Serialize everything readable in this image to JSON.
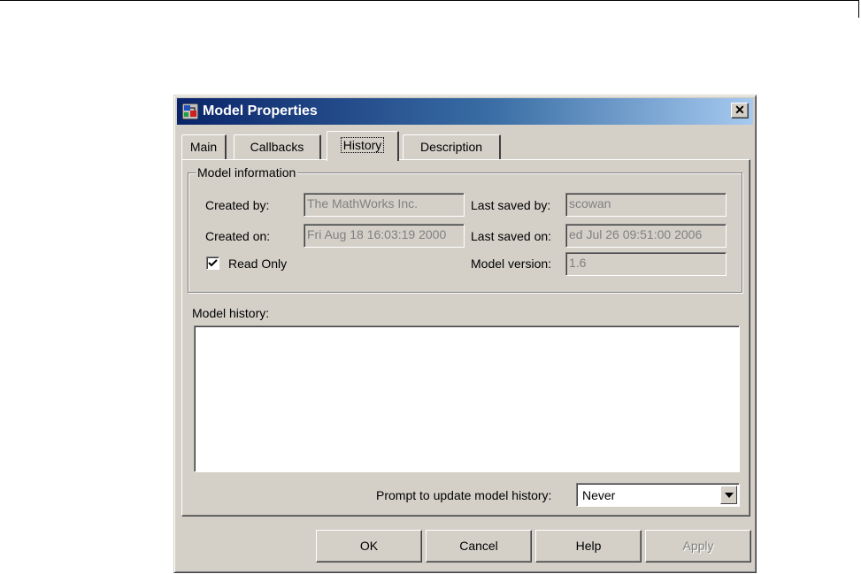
{
  "window": {
    "title": "Model Properties",
    "close_glyph": "✕"
  },
  "tabs": [
    {
      "label": "Main"
    },
    {
      "label": "Callbacks"
    },
    {
      "label": "History",
      "selected": true
    },
    {
      "label": "Description"
    }
  ],
  "model_information": {
    "group_label": "Model information",
    "created_by_label": "Created by:",
    "created_by_value": "The MathWorks Inc.",
    "created_on_label": "Created on:",
    "created_on_value": "Fri Aug 18 16:03:19 2000",
    "last_saved_by_label": "Last saved by:",
    "last_saved_by_value": "scowan",
    "last_saved_on_label": "Last saved on:",
    "last_saved_on_value": "ed Jul 26 09:51:00 2006",
    "model_version_label": "Model version:",
    "model_version_value": "1.6",
    "read_only_label": "Read Only",
    "read_only_checked": true
  },
  "model_history": {
    "label": "Model history:",
    "value": ""
  },
  "prompt": {
    "label": "Prompt to update model history:",
    "selected": "Never"
  },
  "buttons": {
    "ok": "OK",
    "cancel": "Cancel",
    "help": "Help",
    "apply": "Apply"
  },
  "icons": {
    "app": "simulink-model-icon",
    "close": "close-icon",
    "dropdown": "chevron-down-icon",
    "check": "checkmark-icon"
  }
}
